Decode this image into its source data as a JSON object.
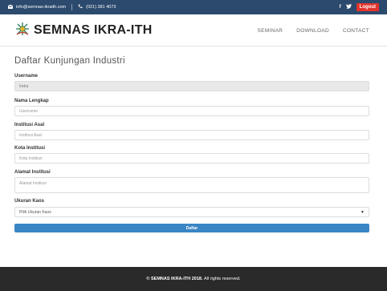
{
  "topbar": {
    "email": "info@semnas-ikraith.com",
    "phone": "(021) 381 4073",
    "facebook": "f",
    "twitter": "t",
    "logout_label": "Logout"
  },
  "header": {
    "logo_text": "SEMNAS IKRA-ITH",
    "nav": [
      "SEMINAR",
      "DOWNLOAD",
      "CONTACT"
    ]
  },
  "page": {
    "title": "Daftar Kunjungan Industri"
  },
  "form": {
    "username": {
      "label": "Username",
      "value": "Indra"
    },
    "nama": {
      "label": "Nama Lengkap",
      "placeholder": "Username"
    },
    "institusi": {
      "label": "Institusi Asal",
      "placeholder": "Institusi Asal"
    },
    "kota": {
      "label": "Kota Institusi",
      "placeholder": "Kota Institusi"
    },
    "alamat": {
      "label": "Alamat Institusi",
      "placeholder": "Alamat Institusi"
    },
    "ukuran": {
      "label": "Ukuran Kaos",
      "selected": "Pilih Ukuran Kaos"
    },
    "submit_label": "Daftar"
  },
  "footer": {
    "brand": "© SEMNAS IKRA-ITH 2018.",
    "rights": "All rights reserved."
  },
  "colors": {
    "topbar": "#2c4a6e",
    "logout": "#e2342c",
    "submit": "#3a86c4",
    "footer": "#2a2a2a"
  }
}
